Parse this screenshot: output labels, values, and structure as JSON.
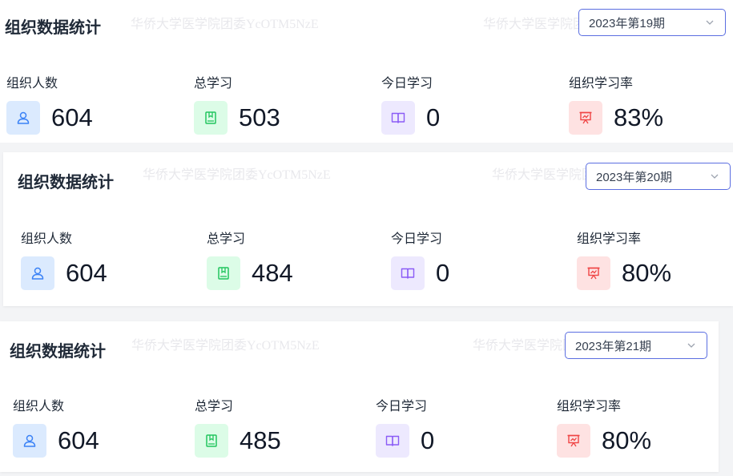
{
  "colors": {
    "accent_border": "#5b6ee1",
    "people": "#3b82f6",
    "total": "#22c55e",
    "today": "#8b5cf6",
    "rate": "#ef4444"
  },
  "watermark_text": "华侨大学医学院团委YcOTM5NzE",
  "panels": [
    {
      "title": "组织数据统计",
      "period": "2023年第19期",
      "stats": [
        {
          "label": "组织人数",
          "value": "604",
          "icon": "user-icon"
        },
        {
          "label": "总学习",
          "value": "503",
          "icon": "book-icon"
        },
        {
          "label": "今日学习",
          "value": "0",
          "icon": "open-book-icon"
        },
        {
          "label": "组织学习率",
          "value": "83%",
          "icon": "presentation-chart-icon"
        }
      ]
    },
    {
      "title": "组织数据统计",
      "period": "2023年第20期",
      "stats": [
        {
          "label": "组织人数",
          "value": "604",
          "icon": "user-icon"
        },
        {
          "label": "总学习",
          "value": "484",
          "icon": "book-icon"
        },
        {
          "label": "今日学习",
          "value": "0",
          "icon": "open-book-icon"
        },
        {
          "label": "组织学习率",
          "value": "80%",
          "icon": "presentation-chart-icon"
        }
      ]
    },
    {
      "title": "组织数据统计",
      "period": "2023年第21期",
      "stats": [
        {
          "label": "组织人数",
          "value": "604",
          "icon": "user-icon"
        },
        {
          "label": "总学习",
          "value": "485",
          "icon": "book-icon"
        },
        {
          "label": "今日学习",
          "value": "0",
          "icon": "open-book-icon"
        },
        {
          "label": "组织学习率",
          "value": "80%",
          "icon": "presentation-chart-icon"
        }
      ]
    }
  ]
}
